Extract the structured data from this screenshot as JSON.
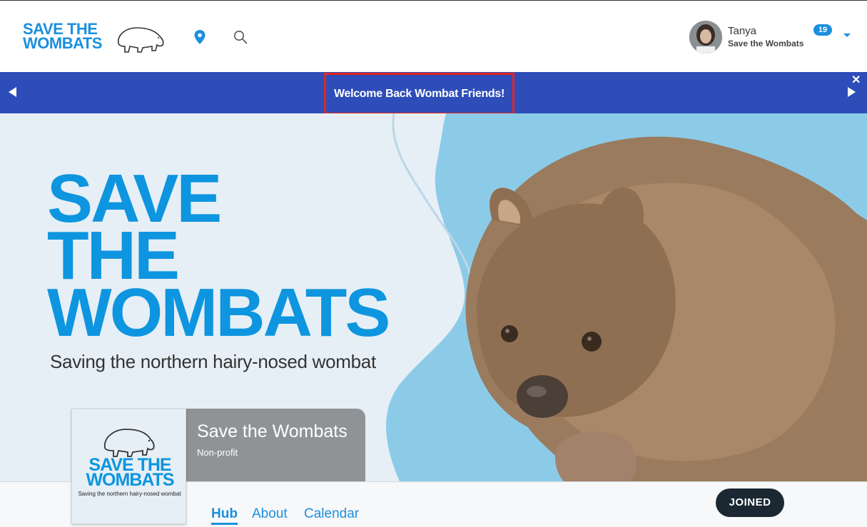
{
  "header": {
    "logo_text_line1": "SAVE THE",
    "logo_text_line2": "WOMBATS",
    "user": {
      "name": "Tanya",
      "org": "Save the Wombats",
      "notification_count": "19"
    }
  },
  "announcement": {
    "message": "Welcome Back Wombat Friends!"
  },
  "banner": {
    "title_line1": "SAVE",
    "title_line2": "THE",
    "title_line3": "WOMBATS",
    "subtitle": "Saving the northern hairy-nosed wombat"
  },
  "group": {
    "thumb_title_line1": "SAVE THE",
    "thumb_title_line2": "WOMBATS",
    "thumb_subtitle": "Saving the northern hairy-nosed wombat",
    "name": "Save the Wombats",
    "type": "Non-profit"
  },
  "nav": {
    "tabs": [
      {
        "label": "Hub",
        "active": true
      },
      {
        "label": "About",
        "active": false
      },
      {
        "label": "Calendar",
        "active": false
      }
    ],
    "joined_label": "JOINED"
  },
  "colors": {
    "brand_blue": "#1b8fde",
    "announcement_bar": "#2e4db8",
    "highlight_border": "#e0281e",
    "joined_button": "#1b2733"
  }
}
